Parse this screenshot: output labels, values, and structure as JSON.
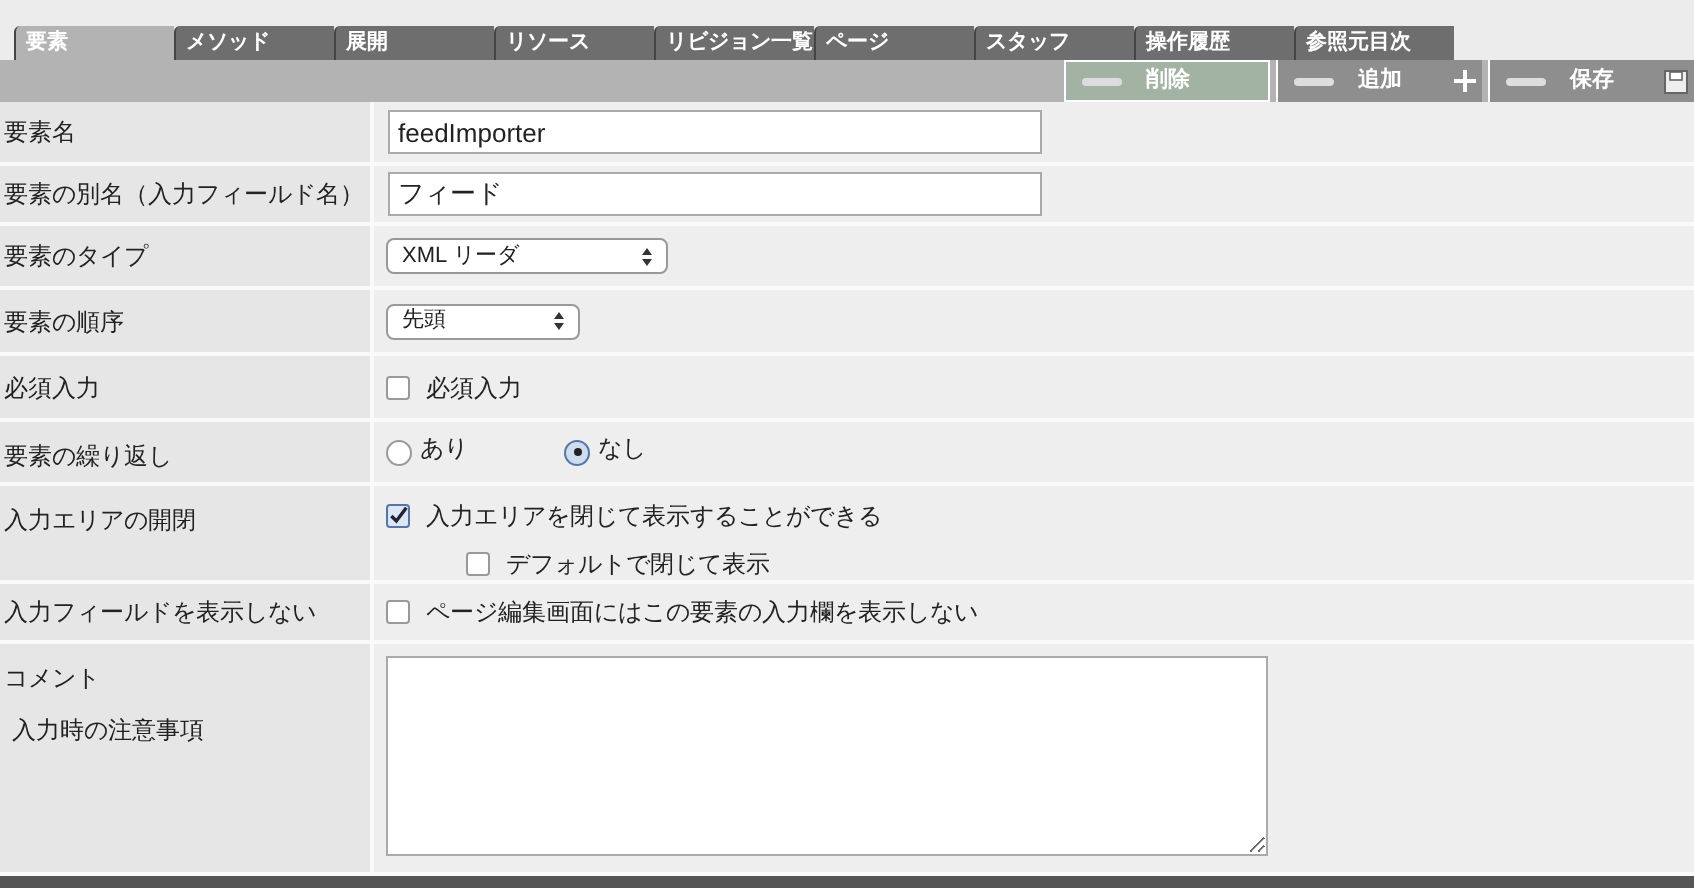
{
  "tabs": [
    {
      "label": "要素",
      "selected": true
    },
    {
      "label": "メソッド",
      "selected": false
    },
    {
      "label": "展開",
      "selected": false
    },
    {
      "label": "リソース",
      "selected": false
    },
    {
      "label": "リビジョン一覧",
      "selected": false
    },
    {
      "label": "ページ",
      "selected": false
    },
    {
      "label": "スタッフ",
      "selected": false
    },
    {
      "label": "操作履歴",
      "selected": false
    },
    {
      "label": "参照元目次",
      "selected": false
    }
  ],
  "toolbar": [
    {
      "label": "削除",
      "kind": "delete"
    },
    {
      "label": "追加",
      "kind": "add"
    },
    {
      "label": "保存",
      "kind": "save"
    }
  ],
  "rows": [
    {
      "label": "要素名",
      "kind": "text",
      "value": "feedImporter"
    },
    {
      "label": "要素の別名（入力フィールド名）",
      "kind": "text",
      "value": "フィード"
    },
    {
      "label": "要素のタイプ",
      "kind": "select",
      "value": "XML リーダ"
    },
    {
      "label": "要素の順序",
      "kind": "select",
      "value": "先頭"
    },
    {
      "label": "必須入力",
      "kind": "checkbox",
      "options": [
        {
          "label": "必須入力",
          "checked": false
        }
      ]
    },
    {
      "label": "要素の繰り返し",
      "kind": "radio",
      "options": [
        {
          "label": "あり",
          "selected": false
        },
        {
          "label": "なし",
          "selected": true
        }
      ]
    },
    {
      "label": "入力エリアの開閉",
      "kind": "checkbox",
      "options": [
        {
          "label": "入力エリアを閉じて表示することができる",
          "checked": true
        },
        {
          "label": "デフォルトで閉じて表示",
          "checked": false
        }
      ]
    },
    {
      "label": "入力フィールドを表示しない",
      "kind": "checkbox",
      "options": [
        {
          "label": "ページ編集画面にはこの要素の入力欄を表示しない",
          "checked": false
        }
      ]
    },
    {
      "label": "コメント",
      "sublabel": "入力時の注意事項",
      "kind": "textarea"
    }
  ]
}
